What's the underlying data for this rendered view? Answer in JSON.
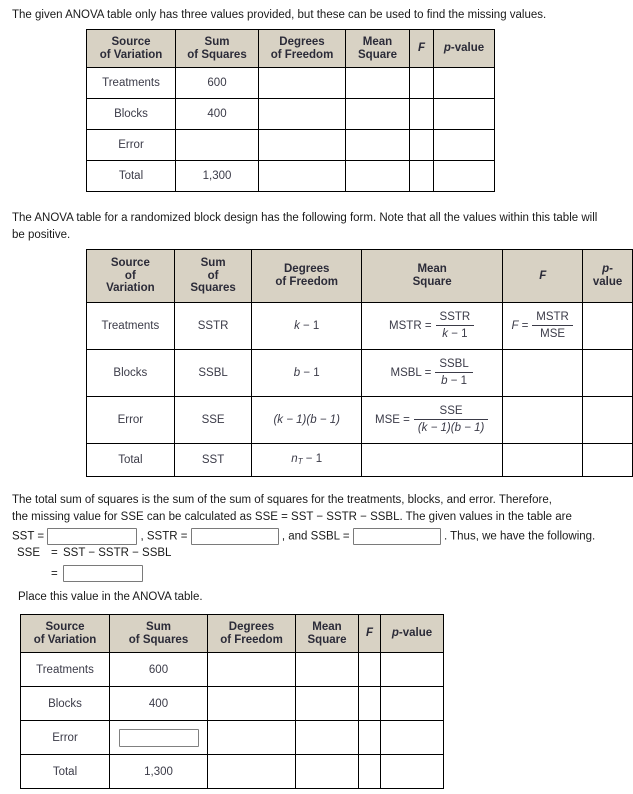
{
  "intro_text": "The given ANOVA table only has three values provided, but these can be used to find the missing values.",
  "para2_text": "The ANOVA table for a randomized block design has the following form. Note that all the values within this table will be positive.",
  "para3": {
    "line1": "The total sum of squares is the sum of the sum of squares for the treatments, blocks, and error. Therefore,",
    "line2": "the missing value for SSE can be calculated as SSE = SST − SSTR − SSBL. The given values in the table are",
    "sst_label": "SST =",
    "sstr_label": ", SSTR =",
    "ssbl_label": ", and SSBL =",
    "tail": ". Thus, we have the following."
  },
  "sse_equation": {
    "lhs": "SSE",
    "eq1": "=",
    "rhs1": "SST − SSTR − SSBL",
    "eq2": "="
  },
  "place_text": "Place this value in the ANOVA table.",
  "table1": {
    "headers": [
      {
        "line1": "Source",
        "line2": "of Variation"
      },
      {
        "line1": "Sum",
        "line2": "of Squares"
      },
      {
        "line1": "Degrees",
        "line2": "of Freedom"
      },
      {
        "line1": "Mean",
        "line2": "Square"
      },
      {
        "line1": "F",
        "line2": ""
      },
      {
        "line1": "p-value",
        "line2": ""
      }
    ],
    "rows": [
      {
        "source": "Treatments",
        "ss": "600",
        "df": "",
        "ms": "",
        "f": "",
        "p": ""
      },
      {
        "source": "Blocks",
        "ss": "400",
        "df": "",
        "ms": "",
        "f": "",
        "p": ""
      },
      {
        "source": "Error",
        "ss": "",
        "df": "",
        "ms": "",
        "f": "",
        "p": ""
      },
      {
        "source": "Total",
        "ss": "1,300",
        "df": "",
        "ms": "",
        "f": "",
        "p": ""
      }
    ]
  },
  "table2": {
    "headers": [
      {
        "line1": "Source",
        "line2": "of",
        "line3": "Variation"
      },
      {
        "line1": "Sum",
        "line2": "of",
        "line3": "Squares"
      },
      {
        "line1": "Degrees",
        "line2": "of Freedom",
        "line3": ""
      },
      {
        "line1": "Mean",
        "line2": "Square",
        "line3": ""
      },
      {
        "line1": "F",
        "line2": "",
        "line3": ""
      },
      {
        "line1": "p-",
        "line2": "value",
        "line3": ""
      }
    ],
    "rows": [
      {
        "source": "Treatments",
        "ss": "SSTR",
        "df_a": "k",
        "df_op": "− 1",
        "ms_lhs": "MSTR =",
        "ms_num": "SSTR",
        "ms_den_it": "k",
        "ms_den_rest": "− 1",
        "f_lhs": "F =",
        "f_num": "MSTR",
        "f_den": "MSE",
        "p": ""
      },
      {
        "source": "Blocks",
        "ss": "SSBL",
        "df_a": "b",
        "df_op": "− 1",
        "ms_lhs": "MSBL =",
        "ms_num": "SSBL",
        "ms_den_it": "b",
        "ms_den_rest": "− 1",
        "f_lhs": "",
        "f_num": "",
        "f_den": "",
        "p": ""
      },
      {
        "source": "Error",
        "ss": "SSE",
        "df_full": "(k − 1)(b − 1)",
        "ms_lhs": "MSE =",
        "ms_num": "SSE",
        "ms_den_full": "(k − 1)(b − 1)",
        "f_lhs": "",
        "p": ""
      },
      {
        "source": "Total",
        "ss": "SST",
        "df_a": "n",
        "df_sub": "T",
        "df_op": "− 1",
        "ms": "",
        "f": "",
        "p": ""
      }
    ]
  },
  "table3": {
    "headers": [
      {
        "line1": "Source",
        "line2": "of Variation"
      },
      {
        "line1": "Sum",
        "line2": "of Squares"
      },
      {
        "line1": "Degrees",
        "line2": "of Freedom"
      },
      {
        "line1": "Mean",
        "line2": "Square"
      },
      {
        "line1": "F",
        "line2": ""
      },
      {
        "line1": "p-value",
        "line2": ""
      }
    ],
    "rows": [
      {
        "source": "Treatments",
        "ss": "600",
        "ss_is_input": false
      },
      {
        "source": "Blocks",
        "ss": "400",
        "ss_is_input": false
      },
      {
        "source": "Error",
        "ss": "",
        "ss_is_input": true
      },
      {
        "source": "Total",
        "ss": "1,300",
        "ss_is_input": false
      }
    ]
  },
  "colors": {
    "header_bg": "#d8d2c4",
    "border": "#000000",
    "text": "#333340",
    "input_border": "#7a7a7a"
  }
}
